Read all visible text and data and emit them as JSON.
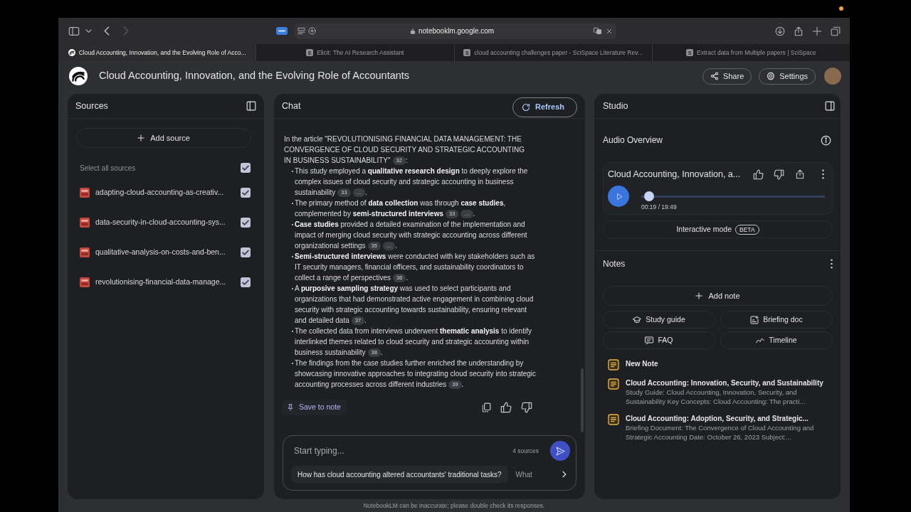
{
  "browser": {
    "navigation": {
      "back_disabled": false,
      "forward_disabled": true
    },
    "address": "notebooklm.google.com",
    "tabs": [
      {
        "title": "Cloud Accounting, Innovation, and the Evolving Role of Acco...",
        "kind": "app",
        "selected": true
      },
      {
        "title": "Elicit: The AI Research Assistant",
        "kind": "letter",
        "letter": "E",
        "selected": false
      },
      {
        "title": "cloud accounting challenges paper - SciSpace Literature Rev...",
        "kind": "letter",
        "letter": "S",
        "selected": false
      },
      {
        "title": "Extract data from Multiple papers | SciSpace",
        "kind": "letter",
        "letter": "S",
        "selected": false
      }
    ]
  },
  "app": {
    "title": "Cloud Accounting, Innovation, and the Evolving Role of Accountants",
    "share_label": "Share",
    "settings_label": "Settings"
  },
  "sources": {
    "title": "Sources",
    "add_label": "Add source",
    "select_all": {
      "label": "Select all sources",
      "checked": true
    },
    "items": [
      {
        "name": "adapting-cloud-accounting-as-creativ...",
        "checked": true
      },
      {
        "name": "data-security-in-cloud-accounting-sys...",
        "checked": true
      },
      {
        "name": "qualitative-analysis-on-costs-and-ben...",
        "checked": true
      },
      {
        "name": "revolutionising-financial-data-manage...",
        "checked": true
      }
    ]
  },
  "chat": {
    "title": "Chat",
    "refresh_label": "Refresh",
    "intro": {
      "text": "In the article \"REVOLUTIONISING FINANCIAL DATA MANAGEMENT: THE CONVERGENCE OF CLOUD SECURITY AND STRATEGIC ACCOUNTING IN BUSINESS SUSTAINABILITY\"",
      "citations": [
        "32"
      ],
      "end": ":"
    },
    "bullets": [
      {
        "text": "This study employed a **qualitative research design** to deeply explore the complex issues of cloud security and strategic accounting in business sustainability",
        "citations": [
          "33",
          "…"
        ],
        "end": "."
      },
      {
        "text": "The primary method of **data collection** was through **case studies**, complemented by **semi-structured interviews**",
        "citations": [
          "33",
          "…"
        ],
        "end": "."
      },
      {
        "text": "**Case studies** provided a detailed examination of the implementation and impact of merging cloud security with strategic accounting across different organizational settings",
        "citations": [
          "35",
          "…"
        ],
        "end": "."
      },
      {
        "text": "**Semi-structured interviews** were conducted with key stakeholders such as IT security managers, financial officers, and sustainability coordinators to collect a range of perspectives",
        "citations": [
          "36"
        ],
        "end": "."
      },
      {
        "text": "A **purposive sampling strategy** was used to select participants and organizations that had demonstrated active engagement in combining cloud security with strategic accounting towards sustainability, ensuring relevant and detailed data",
        "citations": [
          "37"
        ],
        "end": "."
      },
      {
        "text": "The collected data from interviews underwent **thematic analysis** to identify interlinked themes related to cloud security and strategic accounting within business sustainability",
        "citations": [
          "38"
        ],
        "end": "."
      },
      {
        "text": "The findings from the case studies further enriched the understanding by showcasing innovative approaches to integrating cloud security into strategic accounting processes across different industries",
        "citations": [
          "39"
        ],
        "end": "."
      }
    ],
    "save_label": "Save to note",
    "input": {
      "placeholder": "Start typing...",
      "source_count": "4 sources"
    },
    "suggestions": [
      "How has cloud accounting altered accountants' traditional tasks?",
      "What"
    ]
  },
  "studio": {
    "title": "Studio",
    "audio": {
      "heading": "Audio Overview",
      "title": "Cloud Accounting, Innovation, a...",
      "level": 0.016,
      "time": "00:19 / 19:49",
      "interactive_label": "Interactive mode",
      "badge": "BETA"
    },
    "notes": {
      "heading": "Notes",
      "add_label": "Add note",
      "actions": [
        {
          "label": "Study guide",
          "kind": "guide"
        },
        {
          "label": "Briefing doc",
          "kind": "briefing"
        },
        {
          "label": "FAQ",
          "kind": "faq"
        },
        {
          "label": "Timeline",
          "kind": "timeline"
        }
      ],
      "items": [
        {
          "title": "New Note"
        },
        {
          "title": "Cloud Accounting: Innovation, Security, and Sustainability",
          "preview": "Study Guide: Cloud Accounting, Innovation, Security, and Sustainability Key Concepts: Cloud Accounting: The practi..."
        },
        {
          "title": "Cloud Accounting: Adoption, Security, and Strategic...",
          "preview": "Briefing Document: The Convergence of Cloud Accounting and Strategic Accounting Date: October 26, 2023 Subject:..."
        }
      ]
    }
  },
  "footer": "NotebookLM can be inaccurate; please double check its responses."
}
